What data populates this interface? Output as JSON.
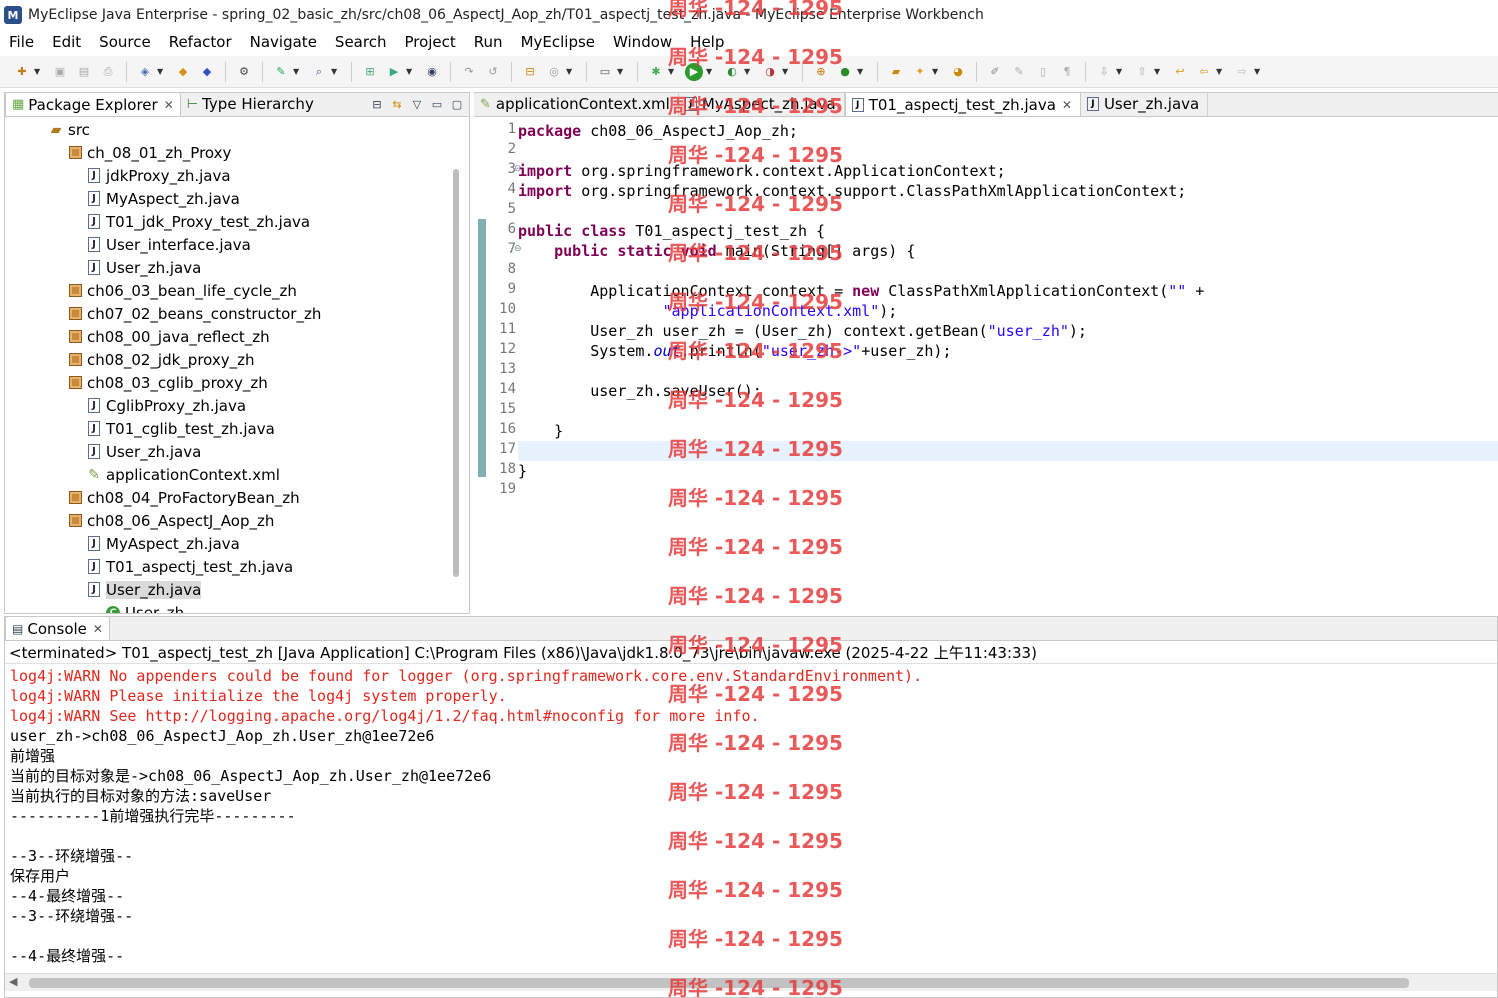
{
  "window": {
    "title": "MyEclipse Java Enterprise - spring_02_basic_zh/src/ch08_06_AspectJ_Aop_zh/T01_aspectj_test_zh.java - MyEclipse Enterprise Workbench"
  },
  "menu": [
    "File",
    "Edit",
    "Source",
    "Refactor",
    "Navigate",
    "Search",
    "Project",
    "Run",
    "MyEclipse",
    "Window",
    "Help"
  ],
  "left_tabs": [
    {
      "label": "Package Explorer",
      "active": true
    },
    {
      "label": "Type Hierarchy",
      "active": false
    }
  ],
  "tree": [
    {
      "label": "src",
      "icon": "src-folder-icon",
      "indent": 1
    },
    {
      "label": "ch_08_01_zh_Proxy",
      "icon": "package-icon",
      "indent": 2
    },
    {
      "label": "jdkProxy_zh.java",
      "icon": "java-file-icon",
      "indent": 3
    },
    {
      "label": "MyAspect_zh.java",
      "icon": "java-file-icon",
      "indent": 3
    },
    {
      "label": "T01_jdk_Proxy_test_zh.java",
      "icon": "java-file-icon",
      "indent": 3
    },
    {
      "label": "User_interface.java",
      "icon": "java-file-icon",
      "indent": 3
    },
    {
      "label": "User_zh.java",
      "icon": "java-file-icon",
      "indent": 3
    },
    {
      "label": "ch06_03_bean_life_cycle_zh",
      "icon": "package-icon",
      "indent": 2
    },
    {
      "label": "ch07_02_beans_constructor_zh",
      "icon": "package-icon",
      "indent": 2
    },
    {
      "label": "ch08_00_java_reflect_zh",
      "icon": "package-icon",
      "indent": 2
    },
    {
      "label": "ch08_02_jdk_proxy_zh",
      "icon": "package-icon",
      "indent": 2
    },
    {
      "label": "ch08_03_cglib_proxy_zh",
      "icon": "package-icon",
      "indent": 2
    },
    {
      "label": "CglibProxy_zh.java",
      "icon": "java-file-icon",
      "indent": 3
    },
    {
      "label": "T01_cglib_test_zh.java",
      "icon": "java-file-icon",
      "indent": 3
    },
    {
      "label": "User_zh.java",
      "icon": "java-file-icon",
      "indent": 3
    },
    {
      "label": "applicationContext.xml",
      "icon": "xml-file-icon",
      "indent": 3
    },
    {
      "label": "ch08_04_ProFactoryBean_zh",
      "icon": "package-icon",
      "indent": 2
    },
    {
      "label": "ch08_06_AspectJ_Aop_zh",
      "icon": "package-icon",
      "indent": 2
    },
    {
      "label": "MyAspect_zh.java",
      "icon": "java-file-icon",
      "indent": 3
    },
    {
      "label": "T01_aspectj_test_zh.java",
      "icon": "java-file-icon",
      "indent": 3
    },
    {
      "label": "User_zh.java",
      "icon": "java-file-icon",
      "indent": 3,
      "selected": true
    },
    {
      "label": "User_zh",
      "icon": "class-icon",
      "indent": 4
    }
  ],
  "editor_tabs": [
    {
      "label": "applicationContext.xml",
      "icon": "xml-file-icon",
      "active": false
    },
    {
      "label": "MyAspect_zh.java",
      "icon": "java-file-icon",
      "active": false
    },
    {
      "label": "T01_aspectj_test_zh.java",
      "icon": "java-file-icon",
      "active": true
    },
    {
      "label": "User_zh.java",
      "icon": "java-file-icon",
      "active": false
    }
  ],
  "code_lines": [
    [
      [
        "kw",
        "package"
      ],
      [
        "t",
        " ch08_06_AspectJ_Aop_zh;"
      ]
    ],
    [],
    [
      [
        "kw",
        "import"
      ],
      [
        "t",
        " org.springframework.context.ApplicationContext;"
      ]
    ],
    [
      [
        "kw",
        "import"
      ],
      [
        "t",
        " org.springframework.context.support.ClassPathXmlApplicationContext;"
      ]
    ],
    [],
    [
      [
        "kw",
        "public"
      ],
      [
        "t",
        " "
      ],
      [
        "kw",
        "class"
      ],
      [
        "t",
        " T01_aspectj_test_zh {"
      ]
    ],
    [
      [
        "t",
        "    "
      ],
      [
        "kw",
        "public"
      ],
      [
        "t",
        " "
      ],
      [
        "kw",
        "static"
      ],
      [
        "t",
        " "
      ],
      [
        "kw",
        "void"
      ],
      [
        "t",
        " main(String[] args) {"
      ]
    ],
    [],
    [
      [
        "t",
        "        ApplicationContext context = "
      ],
      [
        "kw",
        "new"
      ],
      [
        "t",
        " ClassPathXmlApplicationContext("
      ],
      [
        "str",
        "\"\""
      ],
      [
        "t",
        " +"
      ]
    ],
    [
      [
        "t",
        "                "
      ],
      [
        "str",
        "\"applicationContext.xml\""
      ],
      [
        "t",
        ");"
      ]
    ],
    [
      [
        "t",
        "        User_zh user_zh = (User_zh) context.getBean("
      ],
      [
        "str",
        "\"user_zh\""
      ],
      [
        "t",
        ");"
      ]
    ],
    [
      [
        "t",
        "        System."
      ],
      [
        "fld",
        "out"
      ],
      [
        "t",
        ".println("
      ],
      [
        "str",
        "\"user_zh->\""
      ],
      [
        "t",
        "+user_zh);"
      ]
    ],
    [],
    [
      [
        "t",
        "        user_zh.saveUser();"
      ]
    ],
    [],
    [
      [
        "t",
        "    }"
      ]
    ],
    [],
    [
      [
        "t",
        "}"
      ]
    ],
    []
  ],
  "current_line": 17,
  "console": {
    "tab_label": "Console",
    "status": "<terminated> T01_aspectj_test_zh [Java Application] C:\\Program Files (x86)\\Java\\jdk1.8.0_73\\jre\\bin\\javaw.exe (2025-4-22 上午11:43:33)",
    "lines": [
      {
        "text": "log4j:WARN No appenders could be found for logger (org.springframework.core.env.StandardEnvironment).",
        "err": true
      },
      {
        "text": "log4j:WARN Please initialize the log4j system properly.",
        "err": true
      },
      {
        "text": "log4j:WARN See http://logging.apache.org/log4j/1.2/faq.html#noconfig for more info.",
        "err": true
      },
      {
        "text": "user_zh->ch08_06_AspectJ_Aop_zh.User_zh@1ee72e6",
        "err": false
      },
      {
        "text": "前增强",
        "err": false
      },
      {
        "text": "当前的目标对象是->ch08_06_AspectJ_Aop_zh.User_zh@1ee72e6",
        "err": false
      },
      {
        "text": "当前执行的目标对象的方法:saveUser",
        "err": false
      },
      {
        "text": "----------1前增强执行完毕---------",
        "err": false
      },
      {
        "text": "",
        "err": false
      },
      {
        "text": "--3--环绕增强--",
        "err": false
      },
      {
        "text": "保存用户",
        "err": false
      },
      {
        "text": "--4-最终增强--",
        "err": false
      },
      {
        "text": "--3--环绕增强--",
        "err": false
      },
      {
        "text": "",
        "err": false
      },
      {
        "text": "--4-最终增强--",
        "err": false
      }
    ]
  },
  "watermark": "周华 -124 - 1295",
  "colors": {
    "keyword": "#7f0055",
    "string": "#2a00ff",
    "error": "#e0281e",
    "watermark": "#e63c3c"
  }
}
